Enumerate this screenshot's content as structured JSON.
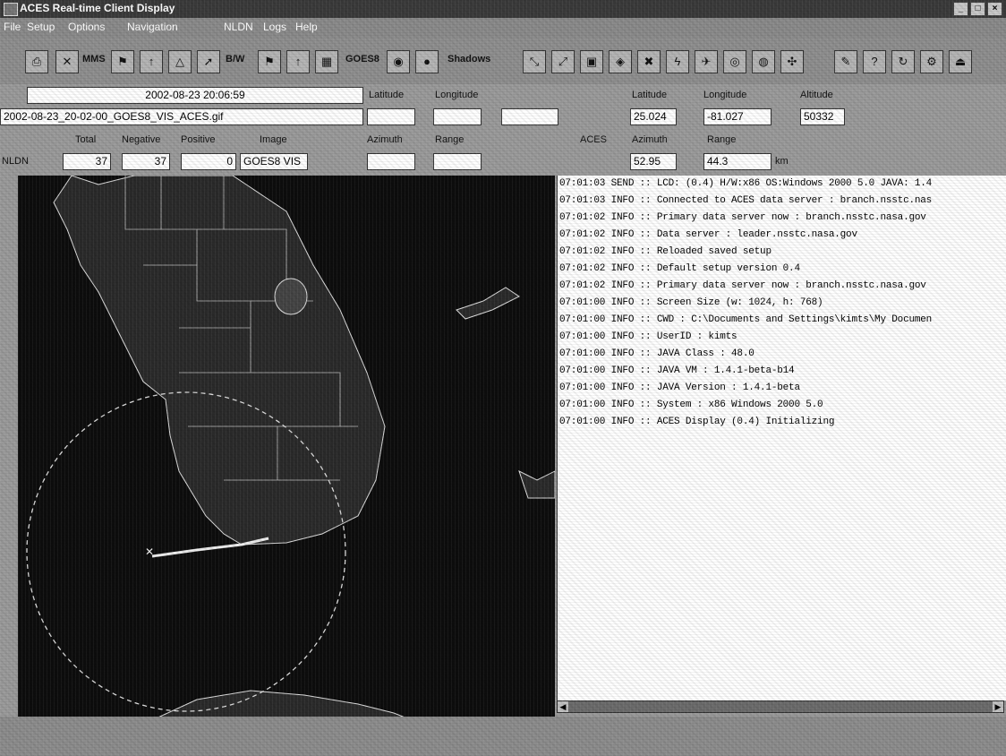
{
  "window": {
    "title": "ACES Real-time Client Display"
  },
  "menu": [
    "File",
    "Setup",
    "Options",
    "Navigation",
    "NLDN",
    "Logs",
    "Help"
  ],
  "toolbar": {
    "label_mms": "MMS",
    "label_bw": "B/W",
    "label_goes": "GOES8",
    "label_shadows": "Shadows"
  },
  "info": {
    "datetime": "2002-08-23 20:06:59",
    "image_file": "2002-08-23_20-02-00_GOES8_VIS_ACES.gif",
    "col_labels": {
      "total": "Total",
      "negative": "Negative",
      "positive": "Positive",
      "image": "Image"
    },
    "row_label": "NLDN",
    "total": "37",
    "negative": "37",
    "positive": "0",
    "image": "GOES8 VIS",
    "latitude_label": "Latitude",
    "longitude_label": "Longitude",
    "azimuth_label": "Azimuth",
    "range_label": "Range"
  },
  "aircraft": {
    "aces_label": "ACES",
    "latitude_label": "Latitude",
    "longitude_label": "Longitude",
    "altitude_label": "Altitude",
    "azimuth_label": "Azimuth",
    "range_label": "Range",
    "latitude": "25.024",
    "longitude": "-81.027",
    "altitude": "50332",
    "azimuth": "52.95",
    "range": "44.3",
    "range_unit": "km"
  },
  "log": [
    "07:01:03 SEND :: LCD: (0.4) H/W:x86 OS:Windows 2000 5.0 JAVA: 1.4",
    "07:01:03 INFO :: Connected to ACES data server : branch.nsstc.nas",
    "07:01:02 INFO :: Primary data server now : branch.nsstc.nasa.gov",
    "07:01:02 INFO :: Data server : leader.nsstc.nasa.gov",
    "07:01:02 INFO :: Reloaded saved setup",
    "07:01:02 INFO :: Default setup version 0.4",
    "07:01:02 INFO :: Primary data server now : branch.nsstc.nasa.gov",
    "07:01:00 INFO :: Screen Size (w: 1024, h: 768)",
    "07:01:00 INFO :: CWD : C:\\Documents and Settings\\kimts\\My Documen",
    "07:01:00 INFO :: UserID : kimts",
    "07:01:00 INFO :: JAVA Class : 48.0",
    "07:01:00 INFO :: JAVA VM : 1.4.1-beta-b14",
    "07:01:00 INFO :: JAVA Version : 1.4.1-beta",
    "07:01:00 INFO :: System : x86 Windows 2000 5.0",
    "07:01:00 INFO :: ACES Display (0.4) Initializing"
  ]
}
